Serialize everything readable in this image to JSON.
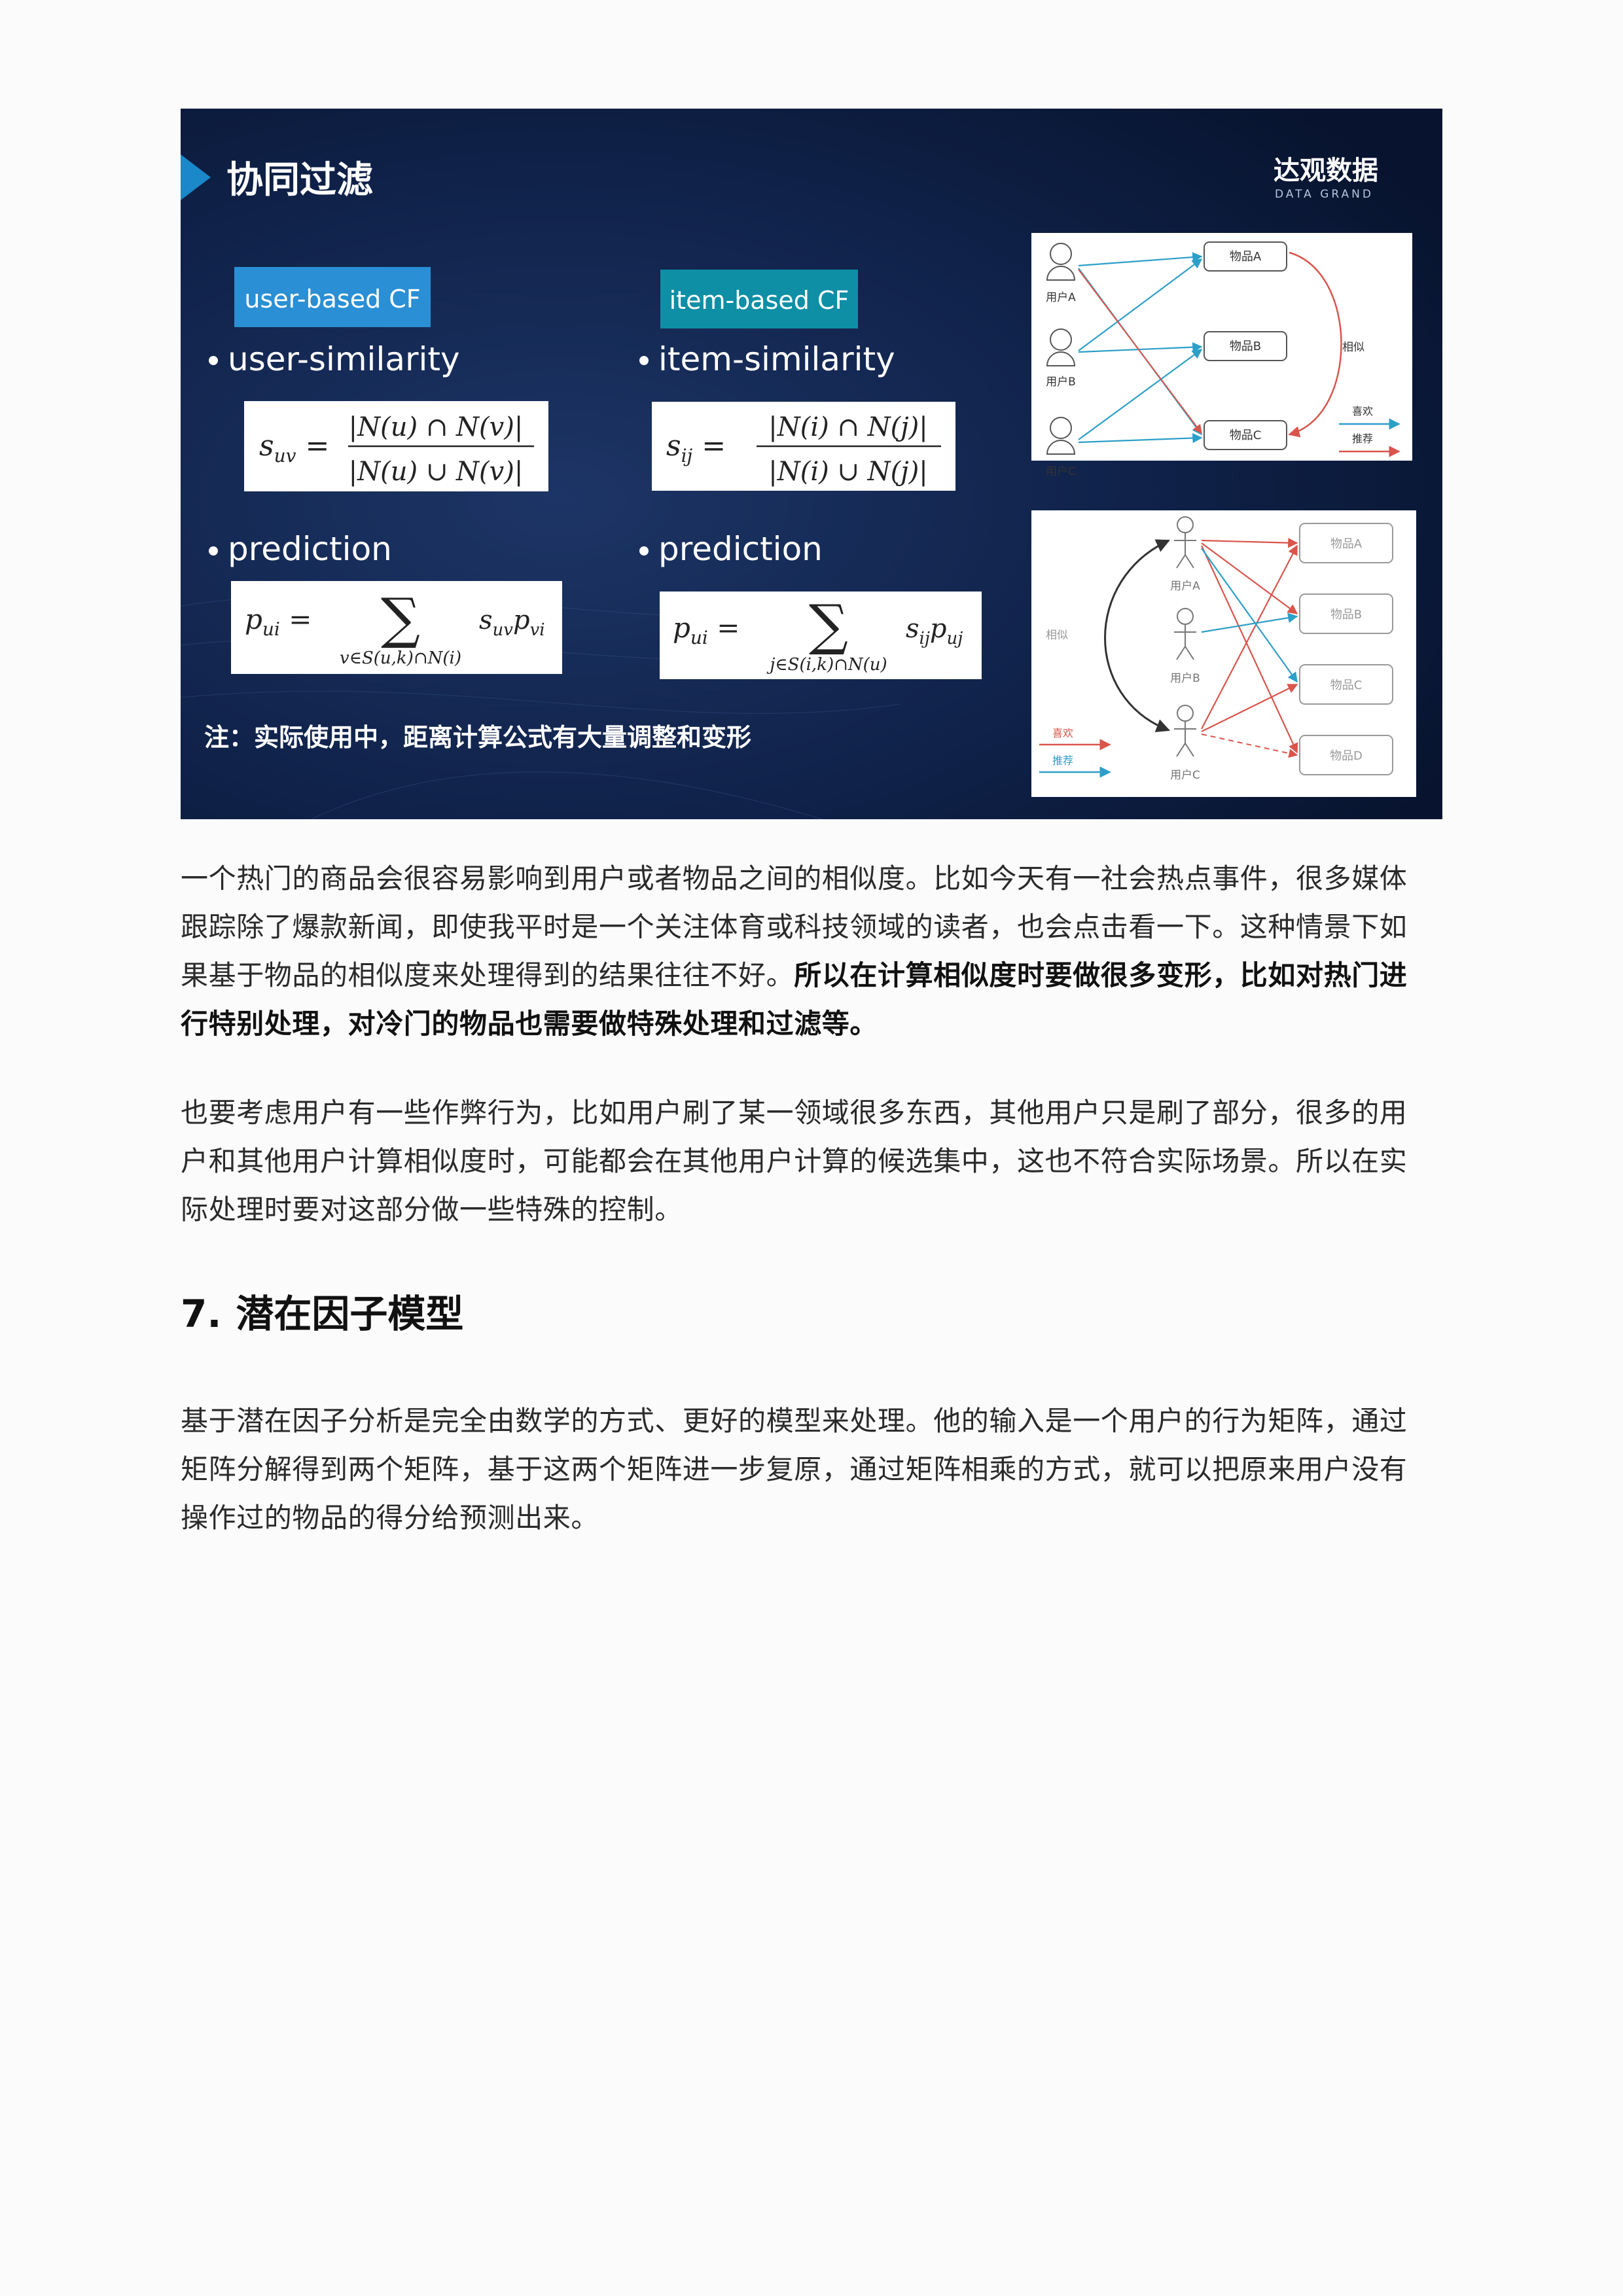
{
  "slide": {
    "title": "协同过滤",
    "brand": {
      "name": "达观数据",
      "tagline": "DATA GRAND"
    },
    "colors": {
      "background": "#0b1a3c",
      "accent": "#1a88c9",
      "user_badge": "#2a8fd4",
      "item_badge": "#0e8fa6",
      "red_arrow": "#d9554c",
      "blue_arrow": "#2c9fc8"
    },
    "user_cf": {
      "badge": "user-based CF",
      "similarity_label": "user-similarity",
      "similarity_formula": {
        "lhs": "s",
        "lhs_sub": "uv",
        "numerator": "|N(u) ∩ N(v)|",
        "denominator": "|N(u) ∪ N(v)|"
      },
      "prediction_label": "prediction",
      "prediction_formula": {
        "lhs": "p",
        "lhs_sub": "ui",
        "sum_under": "v∈S(u,k)∩N(i)",
        "term": "s",
        "term_sub": "uv",
        "term2": "p",
        "term2_sub": "vi"
      }
    },
    "item_cf": {
      "badge": "item-based CF",
      "similarity_label": "item-similarity",
      "similarity_formula": {
        "lhs": "s",
        "lhs_sub": "ij",
        "numerator": "|N(i) ∩ N(j)|",
        "denominator": "|N(i) ∪ N(j)|"
      },
      "prediction_label": "prediction",
      "prediction_formula": {
        "lhs": "p",
        "lhs_sub": "ui",
        "sum_under": "j∈S(i,k)∩N(u)",
        "term": "s",
        "term_sub": "ij",
        "term2": "p",
        "term2_sub": "uj"
      }
    },
    "note": "注：实际使用中，距离计算公式有大量调整和变形",
    "diagram_top": {
      "users": [
        "用户A",
        "用户B",
        "用户C"
      ],
      "items": [
        "物品A",
        "物品B",
        "物品C"
      ],
      "similar_label": "相似",
      "legend": [
        "喜欢",
        "推荐"
      ]
    },
    "diagram_bottom": {
      "users": [
        "用户A",
        "用户B",
        "用户C"
      ],
      "items": [
        "物品A",
        "物品B",
        "物品C",
        "物品D"
      ],
      "similar_label": "相似",
      "legend": [
        "喜欢",
        "推荐"
      ]
    }
  },
  "paragraph1": {
    "lines": [
      "一个热门的商品会很容易影响到用户或者物品之间的相似度。比如今天有一社会热点事件，很多媒体",
      "跟踪除了爆款新闻，即使我平时是一个关注体育或科技领域的读者，也会点击看一下。这种情景下如",
      "果基于物品的相似度来处理得到的结果往往不好。"
    ],
    "bold_lines": [
      "所以在计算相似度时要做很多变形，比如对热门进",
      "行特别处理，对冷门的物品也需要做特殊处理和过滤等。"
    ]
  },
  "paragraph2": {
    "lines": [
      "也要考虑用户有一些作弊行为，比如用户刷了某一领域很多东西，其他用户只是刷了部分，很多的用",
      "户和其他用户计算相似度时，可能都会在其他用户计算的候选集中，这也不符合实际场景。所以在实",
      "际处理时要对这部分做一些特殊的控制。"
    ]
  },
  "heading": {
    "number": "7.",
    "title": "潜在因子模型"
  },
  "paragraph3": {
    "lines": [
      "基于潜在因子分析是完全由数学的方式、更好的模型来处理。他的输入是一个用户的行为矩阵，通过",
      "矩阵分解得到两个矩阵，基于这两个矩阵进一步复原，通过矩阵相乘的方式，就可以把原来用户没有",
      "操作过的物品的得分给预测出来。"
    ]
  }
}
